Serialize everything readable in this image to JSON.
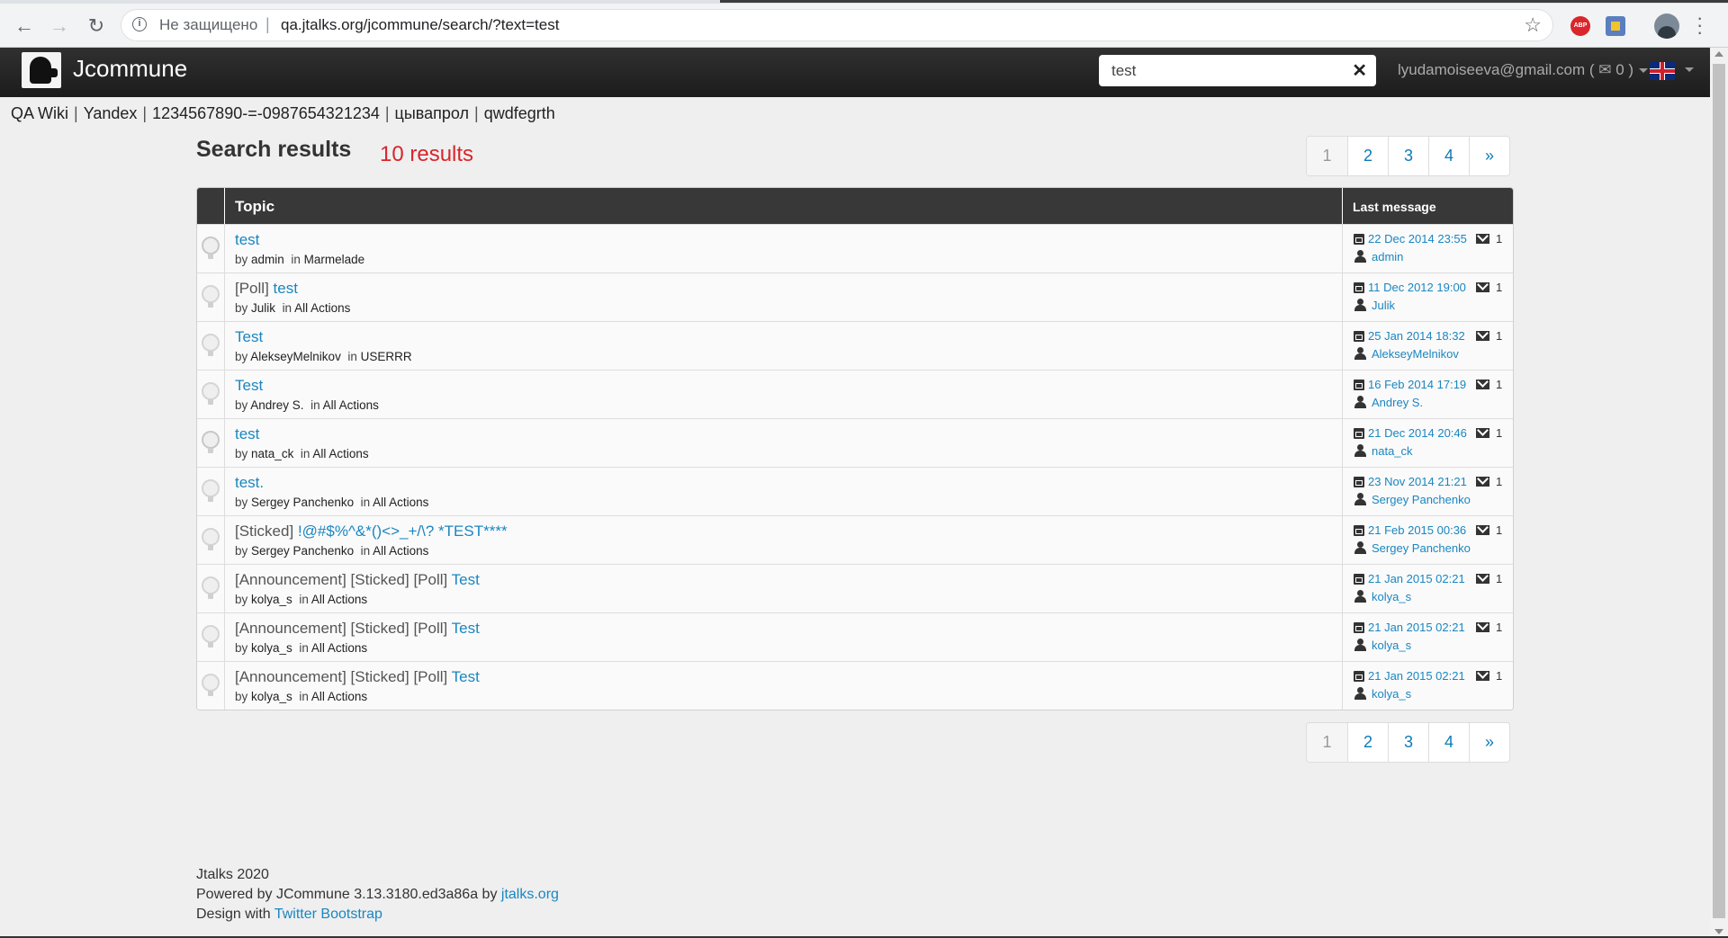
{
  "browser": {
    "insecure_label": "Не защищено",
    "url": "qa.jtalks.org/jcommune/search/?text=test",
    "back_icon": "arrow-left-icon",
    "forward_icon": "arrow-right-icon",
    "reload_icon": "reload-icon",
    "abp_label": "ABP"
  },
  "header": {
    "brand": "Jcommune",
    "search_value": "test",
    "user_email": "lyudamoiseeva@gmail.com",
    "messages_count": "( ✉ 0 )"
  },
  "external_links": [
    "QA Wiki",
    "Yandex",
    "1234567890-=-0987654321234",
    "цывапрол",
    "qwdfegrth"
  ],
  "main": {
    "title": "Search results",
    "results_count": "10 results",
    "pagination": [
      "1",
      "2",
      "3",
      "4",
      "»"
    ],
    "table": {
      "col_topic": "Topic",
      "col_last": "Last message",
      "rows": [
        {
          "prefix": "",
          "title": "test",
          "by": "by",
          "author": "admin",
          "in": "in",
          "branch": "Marmelade",
          "date": "22 Dec 2014 23:55",
          "count": "1",
          "last_user": "admin",
          "icon": "magnify"
        },
        {
          "prefix": "[Poll]",
          "title": "test",
          "by": "by",
          "author": "Julik",
          "in": "in",
          "branch": "All Actions",
          "date": "11 Dec 2012 19:00",
          "count": "1",
          "last_user": "Julik",
          "icon": "bulb"
        },
        {
          "prefix": "",
          "title": "Test",
          "by": "by",
          "author": "AlekseyMelnikov",
          "in": "in",
          "branch": "USERRR",
          "date": "25 Jan 2014 18:32",
          "count": "1",
          "last_user": "AlekseyMelnikov",
          "icon": "bulb"
        },
        {
          "prefix": "",
          "title": "Test",
          "by": "by",
          "author": "Andrey S.",
          "in": "in",
          "branch": "All Actions",
          "date": "16 Feb 2014 17:19",
          "count": "1",
          "last_user": "Andrey S.",
          "icon": "bulb"
        },
        {
          "prefix": "",
          "title": "test",
          "by": "by",
          "author": "nata_ck",
          "in": "in",
          "branch": "All Actions",
          "date": "21 Dec 2014 20:46",
          "count": "1",
          "last_user": "nata_ck",
          "icon": "magnify"
        },
        {
          "prefix": "",
          "title": "test.",
          "by": "by",
          "author": "Sergey Panchenko",
          "in": "in",
          "branch": "All Actions",
          "date": "23 Nov 2014 21:21",
          "count": "1",
          "last_user": "Sergey Panchenko",
          "icon": "bulb"
        },
        {
          "prefix": "[Sticked]",
          "title": "!@#$%^&*()<>_+/\\? *TEST****",
          "by": "by",
          "author": "Sergey Panchenko",
          "in": "in",
          "branch": "All Actions",
          "date": "21 Feb 2015 00:36",
          "count": "1",
          "last_user": "Sergey Panchenko",
          "icon": "bulb"
        },
        {
          "prefix": "[Announcement] [Sticked] [Poll]",
          "title": "Test",
          "by": "by",
          "author": "kolya_s",
          "in": "in",
          "branch": "All Actions",
          "date": "21 Jan 2015 02:21",
          "count": "1",
          "last_user": "kolya_s",
          "icon": "bulb"
        },
        {
          "prefix": "[Announcement] [Sticked] [Poll]",
          "title": "Test",
          "by": "by",
          "author": "kolya_s",
          "in": "in",
          "branch": "All Actions",
          "date": "21 Jan 2015 02:21",
          "count": "1",
          "last_user": "kolya_s",
          "icon": "bulb"
        },
        {
          "prefix": "[Announcement] [Sticked] [Poll]",
          "title": "Test",
          "by": "by",
          "author": "kolya_s",
          "in": "in",
          "branch": "All Actions",
          "date": "21 Jan 2015 02:21",
          "count": "1",
          "last_user": "kolya_s",
          "icon": "bulb"
        }
      ]
    }
  },
  "footer": {
    "line1": "Jtalks 2020",
    "line2_prefix": "Powered by JCommune 3.13.3180.ed3a86a by",
    "line2_link": "jtalks.org",
    "line3_prefix": "Design with",
    "line3_link": "Twitter Bootstrap"
  },
  "colors": {
    "accent_link": "#1a86c1",
    "results_count": "#d7262b",
    "navbar": "#2a2a2a"
  }
}
